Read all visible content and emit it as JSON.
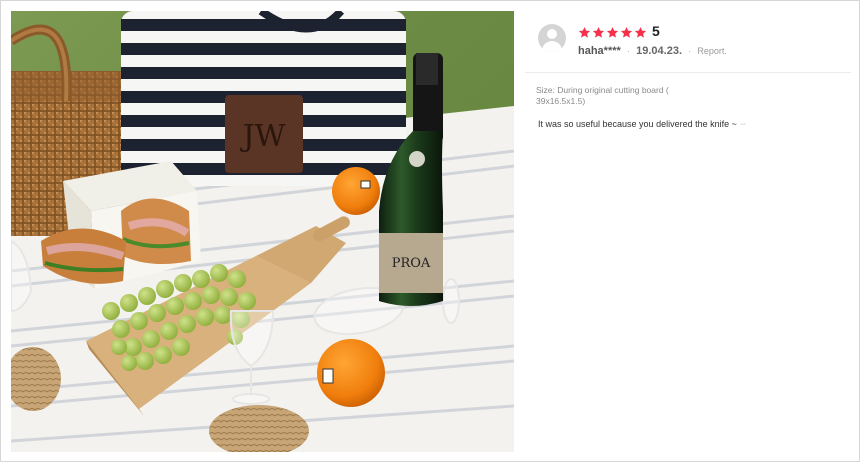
{
  "review": {
    "rating_value": 5,
    "rating_label": "5",
    "username": "haha****",
    "separator": "·",
    "date": "19.04.23.",
    "report_label": "Report.",
    "option_text": "Size: During original cutting board ( 39x16.5x1.5)",
    "review_text": "It was so useful because you delivered the knife ~",
    "emoji": "∽"
  },
  "photo": {
    "bottle_label": "PROA",
    "bag_logo": "JW"
  },
  "colors": {
    "star": "#f4304a",
    "avatar": "#d4d4d4",
    "divider": "#ececec"
  },
  "icons": {
    "avatar": "user-avatar-icon",
    "star": "star-icon"
  }
}
